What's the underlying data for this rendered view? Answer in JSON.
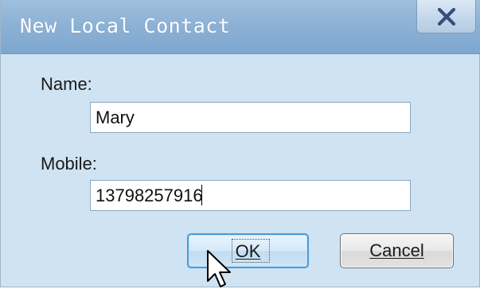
{
  "window": {
    "title": "New Local Contact",
    "close_icon": "close-x-icon"
  },
  "form": {
    "name_label": "Name:",
    "name_value": "Mary",
    "mobile_label": "Mobile:",
    "mobile_value": "13798257916"
  },
  "buttons": {
    "ok_label": "OK",
    "ok_accelerator": "O",
    "cancel_label": "Cancel",
    "cancel_accelerator": "C"
  },
  "colors": {
    "titlebar": "#8db2d6",
    "body": "#cfe3f3",
    "default_button_border": "#4a9bd6"
  },
  "pointer_icon": "arrow-cursor-icon"
}
